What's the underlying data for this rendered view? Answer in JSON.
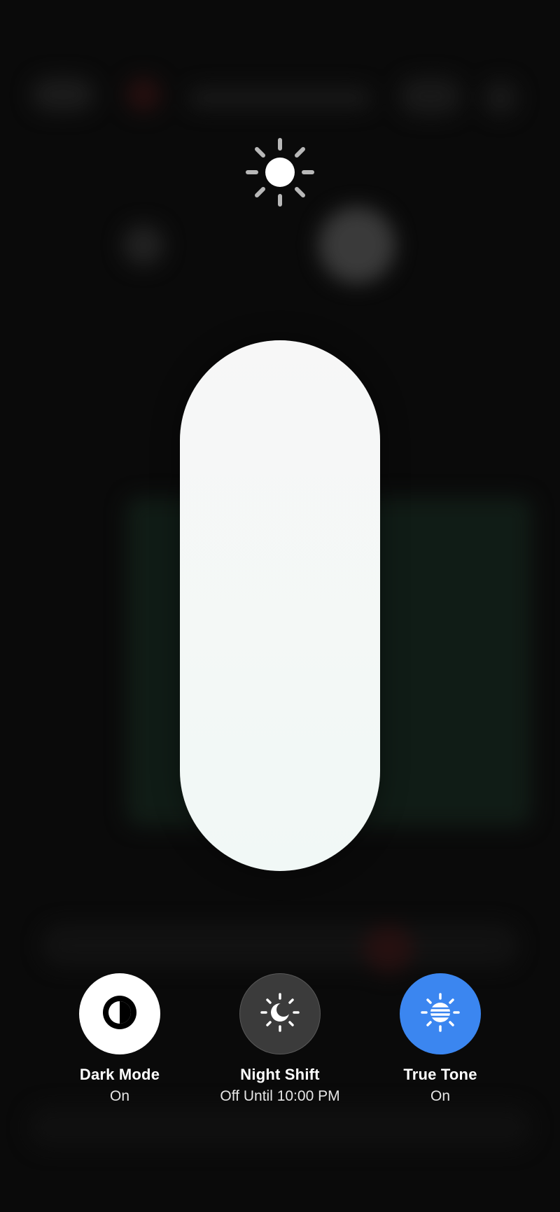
{
  "icons": {
    "brightness": "sun-icon",
    "dark_mode": "half-circle-contrast-icon",
    "night_shift": "sun-moon-icon",
    "true_tone": "sun-lines-icon"
  },
  "brightness": {
    "level": 1.0
  },
  "controls": {
    "dark_mode": {
      "label": "Dark Mode",
      "status": "On"
    },
    "night_shift": {
      "label": "Night Shift",
      "status": "Off Until 10:00 PM"
    },
    "true_tone": {
      "label": "True Tone",
      "status": "On"
    }
  },
  "colors": {
    "accent_blue": "#3b86f0",
    "slider_fill": "#f5f8f7",
    "inactive_button": "#3b3b3b"
  }
}
